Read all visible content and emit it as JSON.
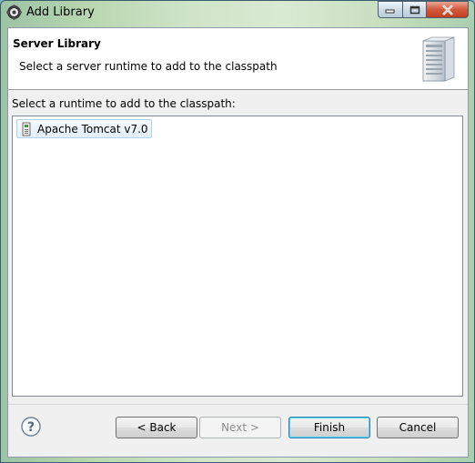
{
  "window": {
    "title": "Add Library"
  },
  "banner": {
    "title": "Server Library",
    "description": "Select a server runtime to add to the classpath"
  },
  "runtimes": {
    "label": "Select a runtime to add to the classpath:",
    "items": [
      {
        "label": "Apache Tomcat v7.0",
        "icon": "tomcat-server-icon"
      }
    ]
  },
  "buttons": {
    "back": "< Back",
    "next": "Next >",
    "finish": "Finish",
    "cancel": "Cancel"
  },
  "colors": {
    "client_bg": "#f0f0f0",
    "selection_border": "#b3d4f0",
    "default_button_glow": "#48d7ff"
  }
}
